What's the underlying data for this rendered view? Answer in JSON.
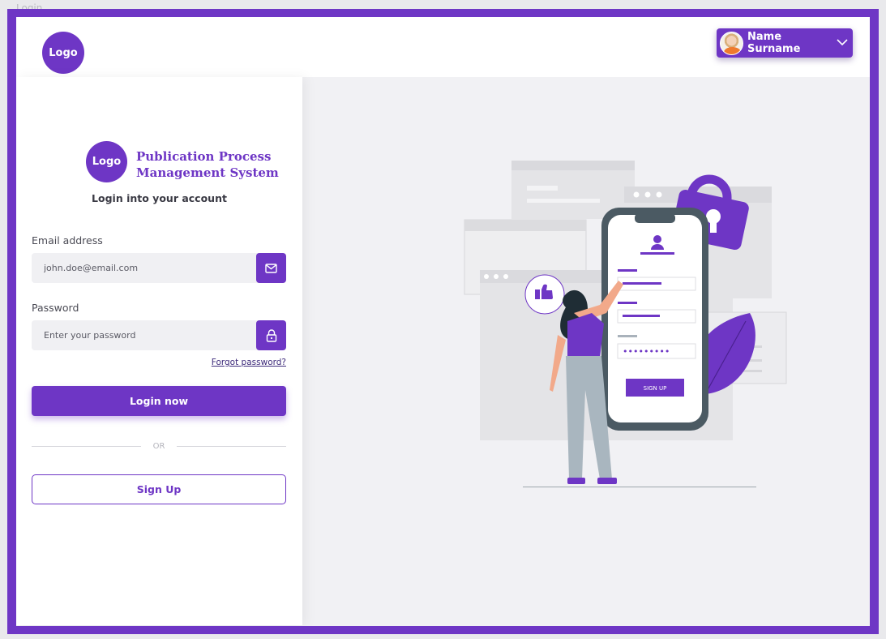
{
  "frame_label": "Login",
  "header": {
    "logo_text": "Logo",
    "user": {
      "name": "Name Surname"
    }
  },
  "login": {
    "logo_text": "Logo",
    "app_title_line1": "Publication Process",
    "app_title_line2": "Management System",
    "subtitle": "Login into your account",
    "email": {
      "label": "Email address",
      "placeholder": "john.doe@email.com"
    },
    "password": {
      "label": "Password",
      "placeholder": "Enter your password"
    },
    "forgot_label": "Forgot password?",
    "login_button": "Login now",
    "or_text": "OR",
    "signup_button": "Sign Up"
  },
  "illustration": {
    "signup_label": "SIGN UP",
    "password_dots": "•••••••••"
  },
  "colors": {
    "accent": "#6e36c5",
    "panel": "#ffffff",
    "background": "#f1f1f4"
  },
  "icons": [
    "mail-icon",
    "lock-icon",
    "chevron-down-icon"
  ]
}
